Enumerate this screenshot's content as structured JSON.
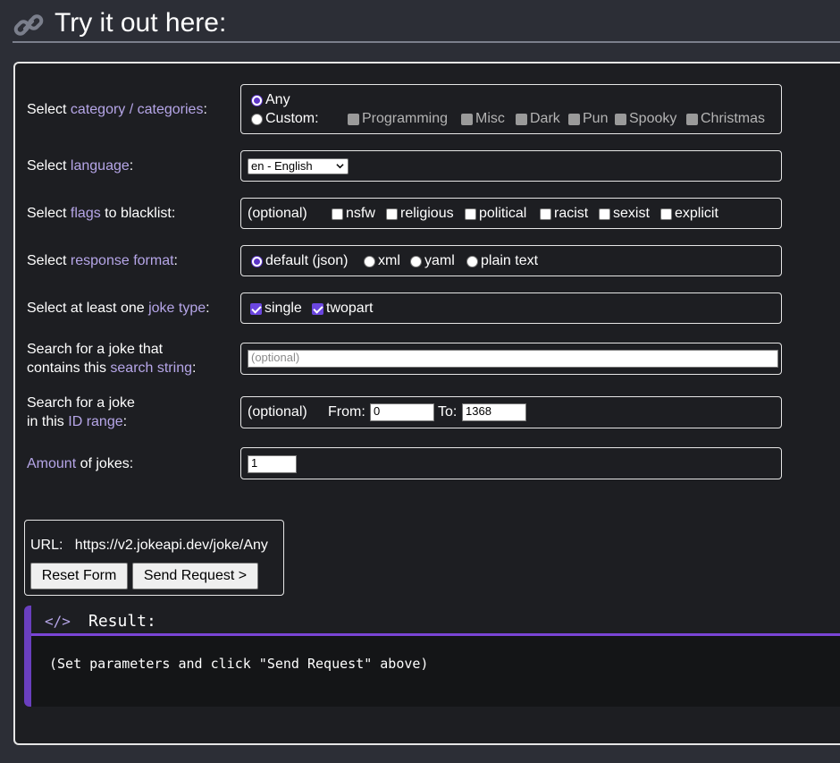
{
  "header": {
    "title": "Try it out here:",
    "icon": "link-icon"
  },
  "form": {
    "category": {
      "label_pre": "Select ",
      "label_hl": "category / categories",
      "label_post": ":",
      "any_label": "Any",
      "custom_label": "Custom:",
      "selected": "Any",
      "options": [
        "Programming",
        "Misc",
        "Dark",
        "Pun",
        "Spooky",
        "Christmas"
      ]
    },
    "language": {
      "label_pre": "Select ",
      "label_hl": "language",
      "label_post": ":",
      "selected": "en - English"
    },
    "flags": {
      "label_pre": "Select ",
      "label_hl": "flags",
      "label_post": " to blacklist:",
      "optional": "(optional)",
      "options": [
        "nsfw",
        "religious",
        "political",
        "racist",
        "sexist",
        "explicit"
      ]
    },
    "format": {
      "label_pre": "Select ",
      "label_hl": "response format",
      "label_post": ":",
      "selected": "default (json)",
      "options": [
        "default (json)",
        "xml",
        "yaml",
        "plain text"
      ]
    },
    "type": {
      "label_pre": "Select at least one ",
      "label_hl": "joke type",
      "label_post": ":",
      "options": [
        "single",
        "twopart"
      ],
      "checked": [
        "single",
        "twopart"
      ]
    },
    "search": {
      "label_line1": "Search for a joke that",
      "label_pre": "contains this ",
      "label_hl": "search string",
      "label_post": ":",
      "placeholder": "(optional)"
    },
    "idrange": {
      "label_line1": "Search for a joke",
      "label_pre": "in this ",
      "label_hl": "ID range",
      "label_post": ":",
      "optional": "(optional)",
      "from_label": "From:",
      "from_value": "0",
      "to_label": "To:",
      "to_value": "1368"
    },
    "amount": {
      "label_hl": "Amount",
      "label_post": " of jokes:",
      "value": "1"
    }
  },
  "url": {
    "label": "URL:",
    "value": "https://v2.jokeapi.dev/joke/Any",
    "reset_label": "Reset Form",
    "send_label": "Send Request >"
  },
  "result": {
    "icon_text": "</>",
    "title": "Result:",
    "placeholder": "(Set parameters and click \"Send Request\" above)"
  },
  "colors": {
    "accent": "#6a3fbf",
    "highlight_text": "#b6a6e8",
    "background": "#2c2e36",
    "panel": "#1d1e22"
  }
}
